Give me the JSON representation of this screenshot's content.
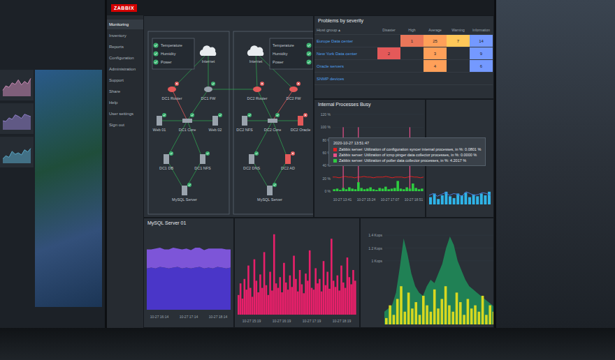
{
  "left_monitor": {
    "tiles": [
      {
        "values": [
          20,
          35,
          30,
          45,
          40,
          55,
          38,
          50,
          42,
          60
        ],
        "color": "#c98bb5"
      },
      {
        "values": [
          30,
          28,
          40,
          35,
          50,
          45,
          38,
          52,
          48,
          44
        ],
        "color": "#8f7fc9"
      },
      {
        "values": [
          15,
          25,
          20,
          40,
          30,
          35,
          28,
          45,
          38,
          50
        ],
        "color": "#5aa9c9"
      }
    ]
  },
  "header": {
    "logo": "ZABBIX"
  },
  "sidebar": {
    "items": [
      {
        "label": "Monitoring",
        "selected": true
      },
      {
        "label": "Inventory",
        "selected": false
      },
      {
        "label": "Reports",
        "selected": false
      },
      {
        "label": "Configuration",
        "selected": false
      },
      {
        "label": "Administration",
        "selected": false
      },
      {
        "label": "Support",
        "selected": false
      },
      {
        "label": "Share",
        "selected": false
      },
      {
        "label": "Help",
        "selected": false
      },
      {
        "label": "User settings",
        "selected": false
      },
      {
        "label": "Sign out",
        "selected": false
      }
    ]
  },
  "network_map": {
    "sensor_boxes": [
      {
        "sensors": [
          {
            "label": "Temperature",
            "ok": true
          },
          {
            "label": "Humidity",
            "ok": true
          },
          {
            "label": "Power",
            "ok": true
          }
        ]
      },
      {
        "sensors": [
          {
            "label": "Temperature",
            "ok": true
          },
          {
            "label": "Humidity",
            "ok": true
          },
          {
            "label": "Power",
            "ok": true
          }
        ]
      }
    ],
    "nodes": [
      {
        "label": "Internet",
        "kind": "cloud",
        "problem": false
      },
      {
        "label": "DC1 Router",
        "kind": "router",
        "problem": true
      },
      {
        "label": "DC1 FW",
        "kind": "router",
        "problem": false
      },
      {
        "label": "Web 01",
        "kind": "server",
        "problem": false
      },
      {
        "label": "DC1 Core",
        "kind": "switch",
        "problem": false
      },
      {
        "label": "Web 02",
        "kind": "server",
        "problem": false
      },
      {
        "label": "DC1 DB",
        "kind": "server",
        "problem": false
      },
      {
        "label": "DC1 NFS",
        "kind": "server",
        "problem": false
      },
      {
        "label": "MySQL Server",
        "kind": "server",
        "problem": false
      },
      {
        "label": "Internet",
        "kind": "cloud",
        "problem": false
      },
      {
        "label": "DC2 Router",
        "kind": "router",
        "problem": true
      },
      {
        "label": "DC2 FW",
        "kind": "router",
        "problem": true
      },
      {
        "label": "DC2 NFS",
        "kind": "server",
        "problem": false
      },
      {
        "label": "DC2 Core",
        "kind": "switch",
        "problem": false
      },
      {
        "label": "DC2 Oracle",
        "kind": "server",
        "problem": true
      },
      {
        "label": "DC2 DNS",
        "kind": "server",
        "problem": false
      },
      {
        "label": "DC2 AD",
        "kind": "server",
        "problem": true
      },
      {
        "label": "MySQL Server",
        "kind": "server",
        "problem": false
      }
    ],
    "links": [
      {
        "from": 0,
        "to": 1,
        "problem": false
      },
      {
        "from": 0,
        "to": 2,
        "problem": false
      },
      {
        "from": 1,
        "to": 4,
        "problem": true
      },
      {
        "from": 2,
        "to": 4,
        "problem": false
      },
      {
        "from": 4,
        "to": 3,
        "problem": false
      },
      {
        "from": 4,
        "to": 5,
        "problem": false
      },
      {
        "from": 4,
        "to": 6,
        "problem": false
      },
      {
        "from": 4,
        "to": 7,
        "problem": false
      },
      {
        "from": 6,
        "to": 8,
        "problem": false
      },
      {
        "from": 7,
        "to": 8,
        "problem": false
      },
      {
        "from": 2,
        "to": 10,
        "problem": false
      },
      {
        "from": 9,
        "to": 10,
        "problem": false
      },
      {
        "from": 9,
        "to": 11,
        "problem": false
      },
      {
        "from": 10,
        "to": 13,
        "problem": false
      },
      {
        "from": 11,
        "to": 13,
        "problem": true
      },
      {
        "from": 13,
        "to": 12,
        "problem": false
      },
      {
        "from": 13,
        "to": 14,
        "problem": false
      },
      {
        "from": 13,
        "to": 15,
        "problem": false
      },
      {
        "from": 13,
        "to": 16,
        "problem": false
      },
      {
        "from": 15,
        "to": 17,
        "problem": false
      },
      {
        "from": 16,
        "to": 17,
        "problem": false
      }
    ]
  },
  "problems": {
    "title": "Problems by severity",
    "host_group_header": "Host group ▴",
    "severities": [
      {
        "label": "Disaster",
        "color": "#e45959"
      },
      {
        "label": "High",
        "color": "#e97659"
      },
      {
        "label": "Average",
        "color": "#ffa059"
      },
      {
        "label": "Warning",
        "color": "#ffc859"
      },
      {
        "label": "Information",
        "color": "#7499ff"
      }
    ],
    "rows": [
      {
        "group": "Europe Data center",
        "counts": [
          "",
          "1",
          "25",
          "7",
          "14"
        ]
      },
      {
        "group": "New York Data center",
        "counts": [
          "2",
          "",
          "3",
          "",
          "9"
        ]
      },
      {
        "group": "Oracle servers",
        "counts": [
          "",
          "",
          "4",
          "",
          "6"
        ]
      },
      {
        "group": "SNMP devices",
        "counts": [
          "",
          "",
          "",
          "",
          ""
        ]
      }
    ]
  },
  "processes_chart": {
    "title": "Internal Processes Busy",
    "y_ticks": [
      {
        "label": "120 %",
        "value": 120
      },
      {
        "label": "100 %",
        "value": 100
      },
      {
        "label": "80 %",
        "value": 80
      },
      {
        "label": "60 %",
        "value": 60
      },
      {
        "label": "40 %",
        "value": 40
      },
      {
        "label": "20 %",
        "value": 20
      },
      {
        "label": "0 %",
        "value": 0
      }
    ],
    "x_ticks": [
      "10-27 13:41",
      "10-27 15:24",
      "10-27 17:07",
      "10-27 18:51"
    ],
    "series": [
      {
        "name": "configuration syncer",
        "kind": "line",
        "color": "#e02020",
        "values": [
          22,
          22,
          21,
          22,
          23,
          22,
          22,
          21,
          22,
          22,
          23,
          22,
          22,
          21,
          22,
          22,
          22,
          23,
          22,
          21,
          22,
          22,
          22,
          21,
          22,
          23,
          22,
          22,
          21,
          22
        ]
      },
      {
        "name": "icmp pinger",
        "kind": "spikes",
        "color": "#e8508a",
        "values": [
          0,
          0,
          0,
          100,
          0,
          0,
          0,
          0,
          100,
          0,
          0,
          0,
          0,
          0,
          0,
          0,
          0,
          0,
          0,
          0,
          0,
          0,
          0,
          0,
          0,
          100,
          0,
          0,
          0,
          0
        ]
      },
      {
        "name": "poller",
        "kind": "bars",
        "color": "#2ecc40",
        "values": [
          3,
          4,
          2,
          5,
          3,
          6,
          4,
          3,
          14,
          5,
          3,
          4,
          6,
          3,
          2,
          5,
          4,
          7,
          3,
          4,
          5,
          16,
          4,
          3,
          6,
          4,
          12,
          5,
          3,
          4
        ]
      }
    ],
    "tooltip": {
      "time": "2020-10-27 13:51:47",
      "lines": [
        "Zabbix server: Utilization of configuration syncer internal processes, in %: 0.0801 %",
        "Zabbix server: Utilization of icmp pinger data collector processes, in %: 0.0000 %",
        "Zabbix server: Utilization of poller data collector processes, in %: 4.2017 %"
      ]
    }
  },
  "side_chart": {
    "line": [
      10,
      12,
      9,
      11,
      13,
      10,
      12,
      11,
      9,
      14,
      12,
      10,
      11,
      13,
      12,
      10
    ],
    "bars": [
      8,
      12,
      6,
      10,
      14,
      9,
      7,
      12,
      10,
      13,
      8,
      11,
      9,
      12,
      10,
      14
    ]
  },
  "mysql_chart": {
    "title": "MySQL Server 01",
    "x_ticks": [
      "10-27 16:14",
      "10-27 17:14",
      "10-27 18:14"
    ],
    "lower": [
      52,
      53,
      52,
      54,
      53,
      52,
      53,
      54,
      52,
      53,
      52,
      53,
      54,
      52,
      53,
      52,
      54,
      53,
      52,
      53
    ],
    "upper": [
      24,
      23,
      25,
      24,
      23,
      24,
      25,
      23,
      24,
      24,
      23,
      25,
      24,
      23,
      24,
      25,
      23,
      24,
      24,
      23
    ]
  },
  "red_chart": {
    "x_ticks": [
      "10-27 15:19",
      "10-27 16:19",
      "10-27 17:19",
      "10-27 18:19"
    ],
    "values": [
      22,
      35,
      18,
      40,
      28,
      55,
      30,
      20,
      62,
      38,
      25,
      45,
      30,
      70,
      33,
      22,
      48,
      27,
      90,
      35,
      30,
      42,
      25,
      58,
      36,
      28,
      44,
      31,
      66,
      40,
      26,
      50,
      34,
      24,
      46,
      38,
      72,
      30,
      28,
      52,
      35,
      40,
      26,
      60,
      33,
      48,
      29,
      85,
      38,
      31,
      44,
      27,
      55,
      36,
      30,
      64,
      42,
      34,
      50,
      38
    ]
  },
  "kops_chart": {
    "y_ticks": [
      {
        "label": "1.4 Kops",
        "value": 1.4
      },
      {
        "label": "1.2 Kops",
        "value": 1.2
      },
      {
        "label": "1 Kops",
        "value": 1
      }
    ],
    "area": [
      0.2,
      0.25,
      0.3,
      0.5,
      0.9,
      1.35,
      1.1,
      0.8,
      0.6,
      0.5,
      0.45,
      0.6,
      0.7,
      0.65,
      0.8,
      0.95,
      1.2,
      1.38,
      1.25,
      1.0,
      0.85,
      0.7,
      0.6,
      0.55,
      0.5,
      0.45,
      0.4,
      0.35,
      0.3,
      0.25
    ],
    "bars": [
      0.1,
      0.3,
      0.15,
      0.4,
      0.6,
      0.2,
      0.5,
      0.25,
      0.35,
      0.15,
      0.45,
      0.3,
      0.2,
      0.55,
      0.25,
      0.4,
      0.6,
      0.3,
      0.2,
      0.5,
      0.35,
      0.15,
      0.4,
      0.25,
      0.3,
      0.2,
      0.45,
      0.15,
      0.3,
      0.2
    ]
  }
}
